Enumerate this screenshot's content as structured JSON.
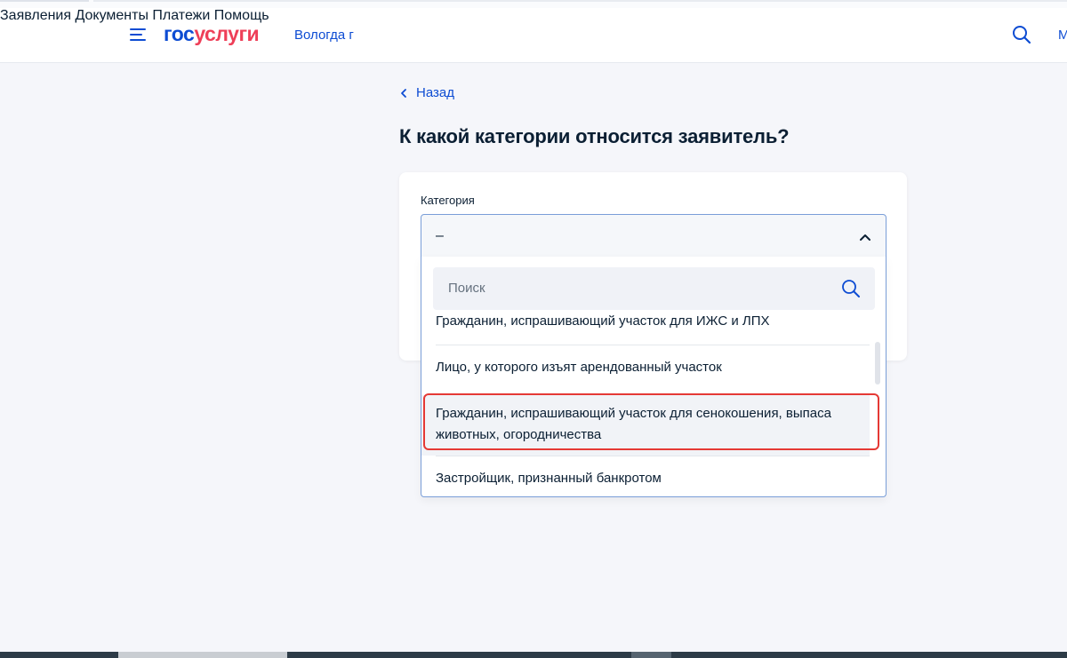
{
  "header": {
    "logo_part1": "гос",
    "logo_part2": "услуги",
    "city": "Вологда г",
    "nav": [
      "Заявления",
      "Документы",
      "Платежи",
      "Помощь"
    ],
    "more_label": "М",
    "brand_color": "#0d4cd3",
    "accent_color": "#ee3f58"
  },
  "back_label": "Назад",
  "page_title": "К какой категории относится заявитель?",
  "form": {
    "field_label": "Категория",
    "selected_value": "–",
    "search_placeholder": "Поиск",
    "options": [
      "Гражданин, испрашивающий участок для ИЖС и ЛПХ",
      "Лицо, у которого изъят арендованный участок",
      "Гражданин, испрашивающий участок для сенокошения, выпаса",
      "животных, огородничества",
      "Застройщик, признанный банкротом"
    ],
    "highlight_color": "#e53935"
  },
  "icons": {
    "menu": "hamburger-icon",
    "search": "search-icon",
    "back": "chevron-left-icon",
    "select": "chevron-up-icon"
  }
}
